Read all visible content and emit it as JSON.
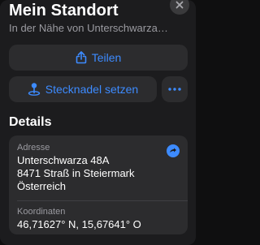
{
  "header": {
    "title": "Mein Standort",
    "subtitle": "In der Nähe von Unterschwarza…"
  },
  "actions": {
    "share_label": "Teilen",
    "pin_label": "Stecknadel setzen",
    "more_label": "•••"
  },
  "details": {
    "heading": "Details",
    "address": {
      "label": "Adresse",
      "lines": [
        "Unterschwarza 48A",
        "8471 Straß in Steiermark",
        "Österreich"
      ]
    },
    "coordinates": {
      "label": "Koordinaten",
      "value": "46,71627° N, 15,67641° O"
    }
  },
  "icons": {
    "close": "close-icon",
    "share": "share-icon",
    "pin": "pin-icon",
    "more": "more-icon",
    "copy": "copy-icon"
  },
  "colors": {
    "accent": "#3d8bff",
    "panel": "#1c1c1e",
    "card": "#2c2c2e",
    "secondary_text": "#9a9aa0"
  }
}
